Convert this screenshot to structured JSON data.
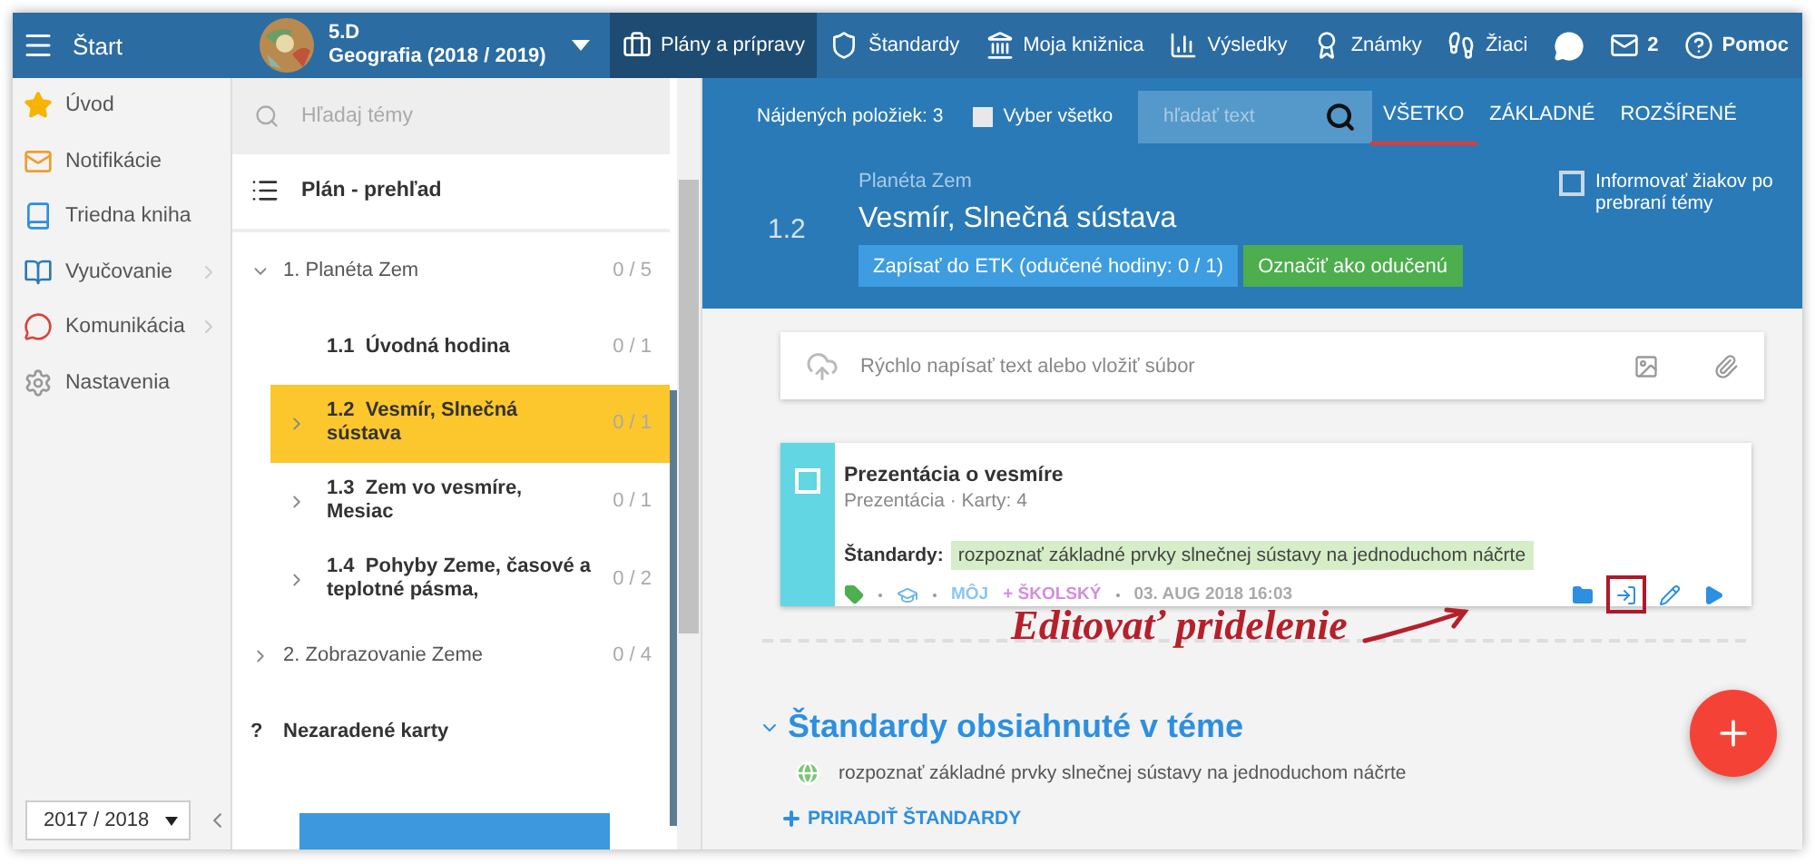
{
  "topbar": {
    "menu_label": "Štart",
    "class_name": "5.D",
    "subject": "Geografia (2018 / 2019)",
    "nav": [
      {
        "label": "Plány a prípravy",
        "selected": true
      },
      {
        "label": "Štandardy",
        "selected": false
      },
      {
        "label": "Moja knižnica",
        "selected": false
      },
      {
        "label": "Výsledky",
        "selected": false
      },
      {
        "label": "Známky",
        "selected": false
      },
      {
        "label": "Žiaci",
        "selected": false
      }
    ],
    "messages_count": "2",
    "help_label": "Pomoc"
  },
  "sidebar": {
    "items": [
      {
        "label": "Úvod",
        "expandable": false
      },
      {
        "label": "Notifikácie",
        "expandable": false
      },
      {
        "label": "Triedna kniha",
        "expandable": false
      },
      {
        "label": "Vyučovanie",
        "expandable": true
      },
      {
        "label": "Komunikácia",
        "expandable": true
      },
      {
        "label": "Nastavenia",
        "expandable": false
      }
    ],
    "year_select": "2017 / 2018"
  },
  "topics": {
    "search_placeholder": "Hľadaj témy",
    "overview": "Plán - prehľad",
    "tree": [
      {
        "title": "1. Planéta Zem",
        "count": "0 / 5",
        "expanded": true,
        "children": [
          {
            "title": "1.1  Úvodná hodina",
            "count": "0 / 1",
            "expandable": false,
            "selected": false
          },
          {
            "title": "1.2  Vesmír, Slnečná sústava",
            "count": "0 / 1",
            "expandable": true,
            "selected": true
          },
          {
            "title": "1.3  Zem vo vesmíre, Mesiac",
            "count": "0 / 1",
            "expandable": true,
            "selected": false
          },
          {
            "title": "1.4  Pohyby Zeme, časové a teplotné pásma,",
            "count": "0 / 2",
            "expandable": true,
            "selected": false
          }
        ]
      },
      {
        "title": "2. Zobrazovanie Zeme",
        "count": "0 / 4",
        "expanded": false
      }
    ],
    "unassigned_icon": "?",
    "unassigned": "Nezaradené karty"
  },
  "toolbar": {
    "found": "Nájdených položiek: 3",
    "select_all": {
      "label": "Vyber všetko",
      "checked": false
    },
    "search_placeholder": "hľadať text",
    "filters": [
      {
        "label": "VŠETKO",
        "selected": true
      },
      {
        "label": "ZÁKLADNÉ",
        "selected": false
      },
      {
        "label": "ROZŠÍRENÉ",
        "selected": false
      }
    ]
  },
  "topic": {
    "parent": "Planéta Zem",
    "number": "1.2",
    "title": "Vesmír, Slnečná sústava",
    "etk_button": "Zapísať do ETK (odučené hodiny: 0 / 1)",
    "mark_button": "Označiť ako odučenú",
    "notify": {
      "label": "Informovať žiakov po prebraní témy",
      "checked": false
    }
  },
  "composer": {
    "placeholder": "Rýchlo napísať text alebo vložiť súbor"
  },
  "cards": [
    {
      "title": "Prezentácia o vesmíre",
      "subtitle": "Prezentácia · Karty: 4",
      "checked": false,
      "standards_label": "Štandardy:",
      "standard": "rozpoznať základné prvky slnečnej sústavy na jednoduchom náčrte",
      "owner": "MÔJ",
      "scope": "+ ŠKOLSKÝ",
      "date": "03. AUG 2018 16:03"
    }
  ],
  "annotation": "Editovať pridelenie",
  "standards": {
    "title": "Štandardy obsiahnuté v téme",
    "items": [
      "rozpoznať základné prvky slnečnej sústavy na jednoduchom náčrte"
    ],
    "assign": "PRIRADIŤ ŠTANDARDY"
  }
}
